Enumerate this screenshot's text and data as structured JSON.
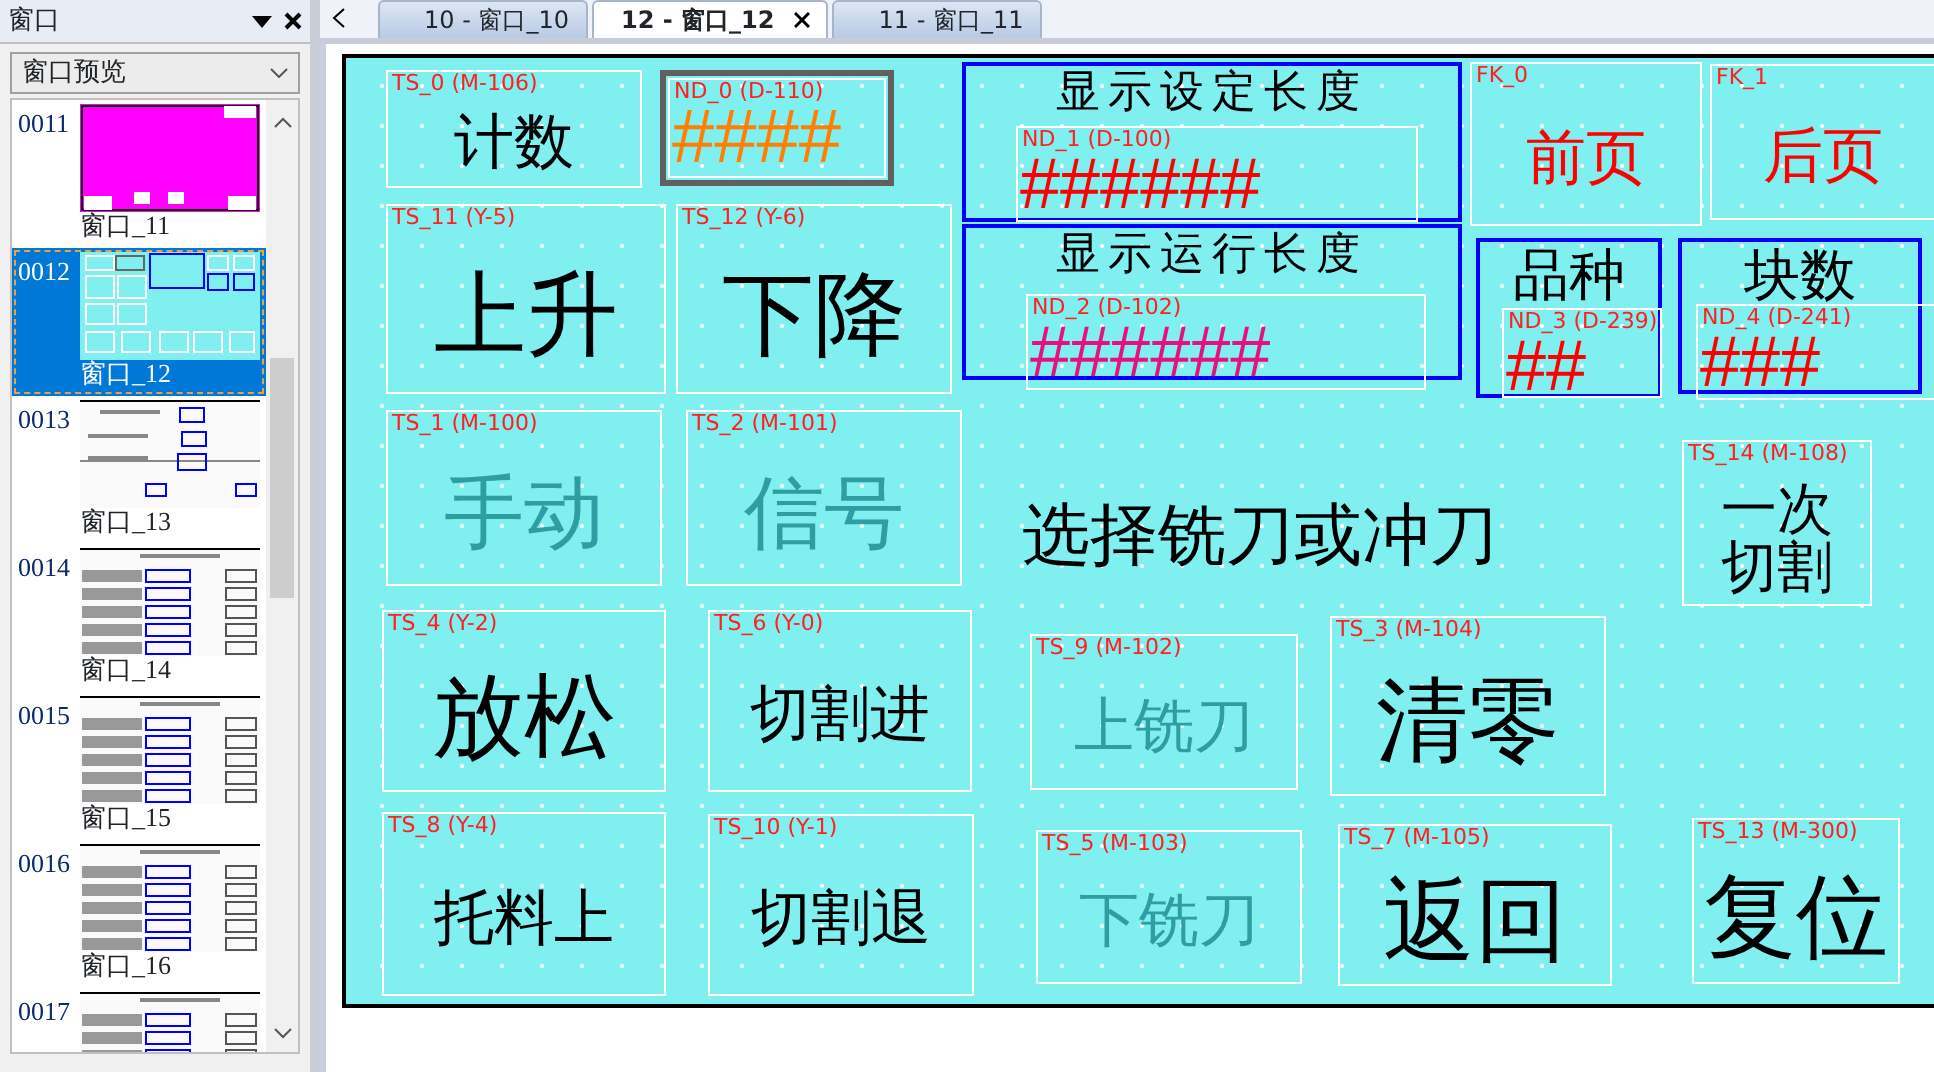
{
  "panel": {
    "title": "窗口",
    "dropdown": {
      "value": "窗口预览"
    },
    "windows": [
      {
        "number": "0011",
        "caption": "窗口_11",
        "selected": false
      },
      {
        "number": "0012",
        "caption": "窗口_12",
        "selected": true
      },
      {
        "number": "0013",
        "caption": "窗口_13",
        "selected": false
      },
      {
        "number": "0014",
        "caption": "窗口_14",
        "selected": false
      },
      {
        "number": "0015",
        "caption": "窗口_15",
        "selected": false
      },
      {
        "number": "0016",
        "caption": "窗口_16",
        "selected": false
      },
      {
        "number": "0017",
        "selected": false
      }
    ]
  },
  "tabs": [
    {
      "label": "10 - 窗口_10",
      "selected": false
    },
    {
      "label": "12 - 窗口_12",
      "selected": true
    },
    {
      "label": "11 - 窗口_11",
      "selected": false
    }
  ],
  "canvas": {
    "objects": [
      {
        "kind": "toggle",
        "tag": "TS_0 (M-106)",
        "label": "计数",
        "dim": false
      },
      {
        "kind": "number",
        "tag": "ND_0 (D-110)",
        "value": "####",
        "color": "#ff8000"
      },
      {
        "kind": "group",
        "title": "显示设定长度"
      },
      {
        "kind": "number",
        "tag": "ND_1 (D-100)",
        "value": "######",
        "color": "#ff0000"
      },
      {
        "kind": "group",
        "title": "显示运行长度"
      },
      {
        "kind": "number",
        "tag": "ND_2 (D-102)",
        "value": "######",
        "color": "#e8107f"
      },
      {
        "kind": "function_key",
        "tag": "FK_0",
        "label": "前页"
      },
      {
        "kind": "function_key",
        "tag": "FK_1",
        "label": "后页"
      },
      {
        "kind": "group",
        "title": "品种"
      },
      {
        "kind": "number",
        "tag": "ND_3 (D-239)",
        "value": "##",
        "color": "#ff0000"
      },
      {
        "kind": "group",
        "title": "块数"
      },
      {
        "kind": "number",
        "tag": "ND_4 (D-241)",
        "value": "###",
        "color": "#ff0000"
      },
      {
        "kind": "toggle",
        "tag": "TS_11 (Y-5)",
        "label": "上升",
        "dim": false
      },
      {
        "kind": "toggle",
        "tag": "TS_12 (Y-6)",
        "label": "下降",
        "dim": false
      },
      {
        "kind": "toggle",
        "tag": "TS_1 (M-100)",
        "label": "手动",
        "dim": true
      },
      {
        "kind": "toggle",
        "tag": "TS_2 (M-101)",
        "label": "信号",
        "dim": true
      },
      {
        "kind": "text",
        "text": "选择铣刀或冲刀"
      },
      {
        "kind": "toggle",
        "tag": "TS_14 (M-108)",
        "label": "一次切割",
        "dim": false
      },
      {
        "kind": "toggle",
        "tag": "TS_4 (Y-2)",
        "label": "放松",
        "dim": false
      },
      {
        "kind": "toggle",
        "tag": "TS_6 (Y-0)",
        "label": "切割进",
        "dim": false
      },
      {
        "kind": "toggle",
        "tag": "TS_9 (M-102)",
        "label": "上铣刀",
        "dim": true
      },
      {
        "kind": "toggle",
        "tag": "TS_3 (M-104)",
        "label": "清零",
        "dim": false
      },
      {
        "kind": "toggle",
        "tag": "TS_8 (Y-4)",
        "label": "托料上",
        "dim": false
      },
      {
        "kind": "toggle",
        "tag": "TS_10 (Y-1)",
        "label": "切割退",
        "dim": false
      },
      {
        "kind": "toggle",
        "tag": "TS_5 (M-103)",
        "label": "下铣刀",
        "dim": true
      },
      {
        "kind": "toggle",
        "tag": "TS_7 (M-105)",
        "label": "返回",
        "dim": false
      },
      {
        "kind": "toggle",
        "tag": "TS_13 (M-300)",
        "label": "复位",
        "dim": false
      }
    ]
  }
}
